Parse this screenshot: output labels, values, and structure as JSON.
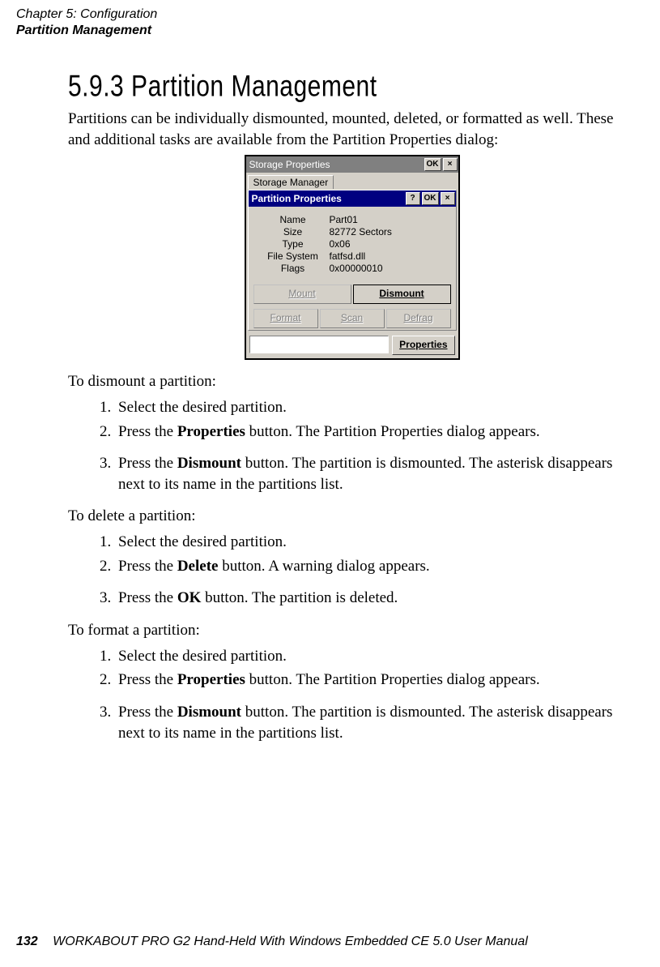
{
  "header": {
    "chapter": "Chapter 5: Configuration",
    "section": "Partition Management"
  },
  "heading": "5.9.3   Partition Management",
  "intro": "Partitions can be individually dismounted, mounted, deleted, or formatted as well. These and additional tasks are available from the Partition Properties dialog:",
  "screenshot": {
    "outer_title": "Storage Properties",
    "ok": "OK",
    "close_glyph": "×",
    "help_glyph": "?",
    "tab": "Storage Manager",
    "inner_title": "Partition Properties",
    "fields": {
      "name_label": "Name",
      "name_value": "Part01",
      "size_label": "Size",
      "size_value": "82772 Sectors",
      "type_label": "Type",
      "type_value": "0x06",
      "fs_label": "File System",
      "fs_value": "fatfsd.dll",
      "flags_label": "Flags",
      "flags_value": "0x00000010"
    },
    "buttons": {
      "mount": "Mount",
      "dismount": "Dismount",
      "format": "Format",
      "scan": "Scan",
      "defrag": "Defrag",
      "properties": "Properties"
    }
  },
  "dismount_heading": "To dismount a partition:",
  "dismount_steps": {
    "s1": "Select the desired partition.",
    "s2a": "Press the ",
    "s2b": "Properties",
    "s2c": " button. The Partition Properties dialog appears.",
    "s3a": "Press the ",
    "s3b": "Dismount",
    "s3c": " button. The partition is dismounted. The asterisk disappears next to its name in the partitions list."
  },
  "delete_heading": "To delete a partition:",
  "delete_steps": {
    "s1": "Select the desired partition.",
    "s2a": "Press the ",
    "s2b": "Delete",
    "s2c": " button. A warning dialog appears.",
    "s3a": "Press the ",
    "s3b": "OK",
    "s3c": " button. The partition is deleted."
  },
  "format_heading": "To format a partition:",
  "format_steps": {
    "s1": "Select the desired partition.",
    "s2a": "Press the ",
    "s2b": "Properties",
    "s2c": " button. The Partition Properties dialog appears.",
    "s3a": "Press the ",
    "s3b": "Dismount",
    "s3c": " button. The partition is dismounted. The asterisk disappears next to its name in the partitions list."
  },
  "footer": {
    "page": "132",
    "title": "WORKABOUT PRO G2 Hand-Held With Windows Embedded CE 5.0 User Manual"
  }
}
